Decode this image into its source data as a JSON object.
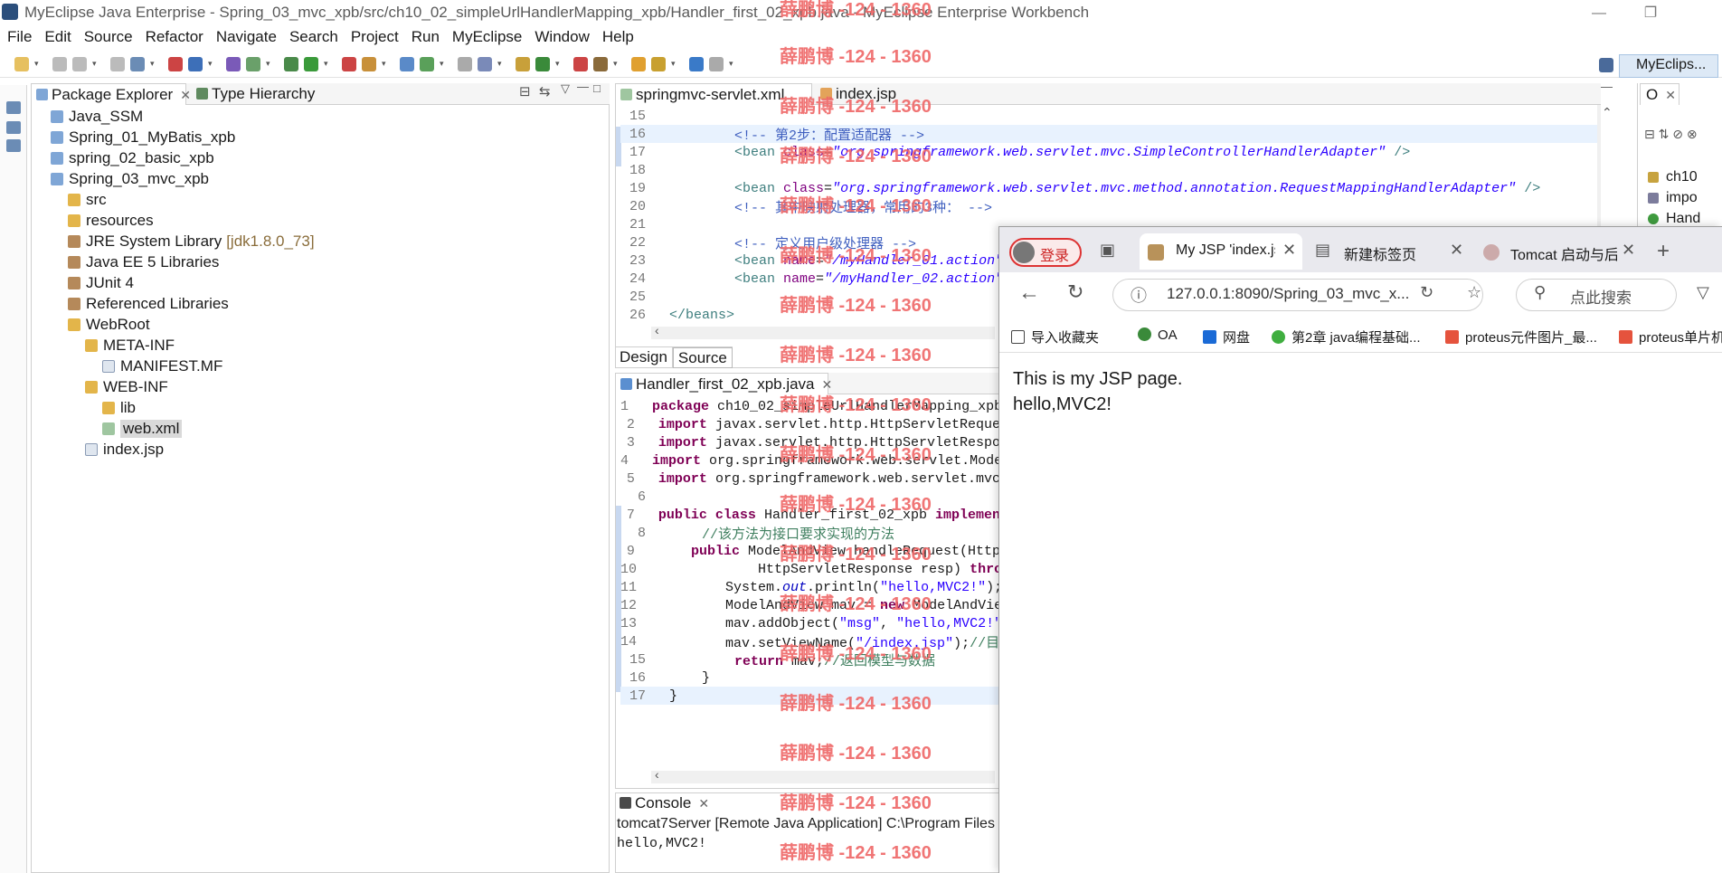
{
  "window": {
    "title": "MyEclipse Java Enterprise - Spring_03_mvc_xpb/src/ch10_02_simpleUrlHandlerMapping_xpb/Handler_first_02_xpb.java - MyEclipse Enterprise Workbench",
    "minimize": "—",
    "restore": "❐"
  },
  "menubar": [
    "File",
    "Edit",
    "Source",
    "Refactor",
    "Navigate",
    "Search",
    "Project",
    "Run",
    "MyEclipse",
    "Window",
    "Help"
  ],
  "perspective": {
    "label": "MyEclips..."
  },
  "package_explorer": {
    "tab_label": "Package Explorer",
    "tab2_label": "Type Hierarchy",
    "tree": [
      {
        "label": "Java_SSM",
        "depth": 0,
        "icon": "project-icon"
      },
      {
        "label": "Spring_01_MyBatis_xpb",
        "depth": 0,
        "icon": "project-icon"
      },
      {
        "label": "spring_02_basic_xpb",
        "depth": 0,
        "icon": "project-icon"
      },
      {
        "label": "Spring_03_mvc_xpb",
        "depth": 0,
        "icon": "project-icon"
      },
      {
        "label": "src",
        "depth": 1,
        "icon": "source-folder-icon"
      },
      {
        "label": "resources",
        "depth": 1,
        "icon": "source-folder-icon"
      },
      {
        "label": "JRE System Library",
        "suffix": "[jdk1.8.0_73]",
        "depth": 1,
        "icon": "library-icon"
      },
      {
        "label": "Java EE 5 Libraries",
        "depth": 1,
        "icon": "library-icon"
      },
      {
        "label": "JUnit 4",
        "depth": 1,
        "icon": "library-icon"
      },
      {
        "label": "Referenced Libraries",
        "depth": 1,
        "icon": "library-icon"
      },
      {
        "label": "WebRoot",
        "depth": 1,
        "icon": "folder-icon"
      },
      {
        "label": "META-INF",
        "depth": 2,
        "icon": "folder-icon"
      },
      {
        "label": "MANIFEST.MF",
        "depth": 3,
        "icon": "file-icon"
      },
      {
        "label": "WEB-INF",
        "depth": 2,
        "icon": "folder-icon"
      },
      {
        "label": "lib",
        "depth": 3,
        "icon": "folder-icon"
      },
      {
        "label": "web.xml",
        "depth": 3,
        "icon": "xml-file-icon",
        "selected": true
      },
      {
        "label": "index.jsp",
        "depth": 2,
        "icon": "jsp-file-icon"
      }
    ]
  },
  "editor_top": {
    "tabs": [
      "springmvc-servlet.xml",
      "index.jsp"
    ],
    "lines": [
      {
        "n": "15",
        "html": ""
      },
      {
        "n": "16",
        "html": "<span class=\"cmt\">&lt;!-- 第2步：配置适配器 --&gt;</span>",
        "indent": 2,
        "hl": true
      },
      {
        "n": "17",
        "html": "<span class=\"tag\">&lt;bean</span> <span class=\"attr\">class</span>=<span class=\"str\">\"org.springframework.web.servlet.mvc.SimpleControllerHandlerAdapter\"</span> <span class=\"tag\">/&gt;</span>",
        "indent": 2
      },
      {
        "n": "18",
        "html": ""
      },
      {
        "n": "19",
        "html": "<span class=\"tag\">&lt;bean</span> <span class=\"attr\">class</span>=<span class=\"str\">\"org.springframework.web.servlet.mvc.method.annotation.RequestMappingHandlerAdapter\"</span> <span class=\"tag\">/&gt;</span>",
        "indent": 2
      },
      {
        "n": "20",
        "html": "<span class=\"cmt\">&lt;!-- 其中映射处理器，常用的3种： --&gt;</span>",
        "indent": 2
      },
      {
        "n": "21",
        "html": ""
      },
      {
        "n": "22",
        "html": "<span class=\"cmt\">&lt;!-- 定义用户级处理器 --&gt;</span>",
        "indent": 2
      },
      {
        "n": "23",
        "html": "<span class=\"tag\">&lt;bean</span> <span class=\"attr\">name</span>=<span class=\"str\">\"/myHandler_01.action\"</span>",
        "indent": 2
      },
      {
        "n": "24",
        "html": "<span class=\"tag\">&lt;bean</span> <span class=\"attr\">name</span>=<span class=\"str\">\"/myHandler_02.action\"</span>",
        "indent": 2
      },
      {
        "n": "25",
        "html": ""
      },
      {
        "n": "26",
        "html": "<span class=\"tag\">&lt;/beans&gt;</span>",
        "indent": 0
      }
    ],
    "design_tab": "Design",
    "source_tab": "Source"
  },
  "editor_java": {
    "tab": "Handler_first_02_xpb.java",
    "lines": [
      {
        "n": "1",
        "html": "<span class=\"kw\">package</span> ch10_02_simpleUrlHandlerMapping_xpb",
        "indent": 0
      },
      {
        "n": "2",
        "html": "<span class=\"kw\">import</span> javax.servlet.http.HttpServletReque",
        "indent": 0
      },
      {
        "n": "3",
        "html": "<span class=\"kw\">import</span> javax.servlet.http.HttpServletRespo",
        "indent": 0
      },
      {
        "n": "4",
        "html": "<span class=\"kw\">import</span> org.springframework.web.servlet.Mode",
        "indent": 0
      },
      {
        "n": "5",
        "html": "<span class=\"kw\">import</span> org.springframework.web.servlet.mvc",
        "indent": 0
      },
      {
        "n": "6",
        "html": ""
      },
      {
        "n": "7",
        "html": "<span class=\"kw\">public class</span> Handler_first_02_xpb <span class=\"kw\">implemen</span>",
        "indent": 0
      },
      {
        "n": "8",
        "html": "<span class=\"jcmt\">//该方法为接口要求实现的方法</span>",
        "indent": 1
      },
      {
        "n": "9",
        "html": "<span class=\"kw\">public</span> ModelAndView handleRequest(Http",
        "indent": 1
      },
      {
        "n": "10",
        "html": "HttpServletResponse resp) <span class=\"kw\">throw</span>",
        "indent": 3
      },
      {
        "n": "11",
        "html": "System.<span class=\"static\">out</span>.println(<span class=\"strn\">\"hello,MVC2!\"</span>);",
        "indent": 2
      },
      {
        "n": "12",
        "html": "ModelAndView mav = <span class=\"kw\">new</span> ModelAndView",
        "indent": 2
      },
      {
        "n": "13",
        "html": "mav.addObject(<span class=\"strn\">\"msg\"</span>, <span class=\"strn\">\"hello,MVC2!\"</span>",
        "indent": 2
      },
      {
        "n": "14",
        "html": "mav.setViewName(<span class=\"strn\">\"/index.jsp\"</span>);<span class=\"jcmt\">//目标</span>",
        "indent": 2
      },
      {
        "n": "15",
        "html": "<span class=\"kw\">return</span> mav;<span class=\"jcmt\">//返回模型与数据</span>",
        "indent": 2
      },
      {
        "n": "16",
        "html": "}",
        "indent": 1
      },
      {
        "n": "17",
        "html": "}",
        "indent": 0,
        "hl": true
      }
    ]
  },
  "console": {
    "tab": "Console",
    "description": "tomcat7Server [Remote Java Application] C:\\Program Files",
    "output": "hello,MVC2!"
  },
  "outline": {
    "tab": "O",
    "items": [
      "ch10",
      "impo",
      "Hand"
    ]
  },
  "browser": {
    "login": "登录",
    "tabs": [
      "My JSP 'index.jsp",
      "新建标签页",
      "Tomcat 启动与后"
    ],
    "url": "127.0.0.1:8090/Spring_03_mvc_x...",
    "search_placeholder": "点此搜索",
    "bookmarks": [
      "导入收藏夹",
      "OA",
      "网盘",
      "第2章 java编程基础...",
      "proteus元件图片_最...",
      "proteus单片机"
    ],
    "page_text": [
      "This is my JSP page.",
      "hello,MVC2!"
    ]
  },
  "watermark": "薛鹏博 -124 - 1360",
  "colors": {
    "accent": "#dde9f6",
    "keyword": "#7f0055",
    "string": "#2a00ff",
    "watermark": "#ef6767",
    "login": "#d33333"
  }
}
